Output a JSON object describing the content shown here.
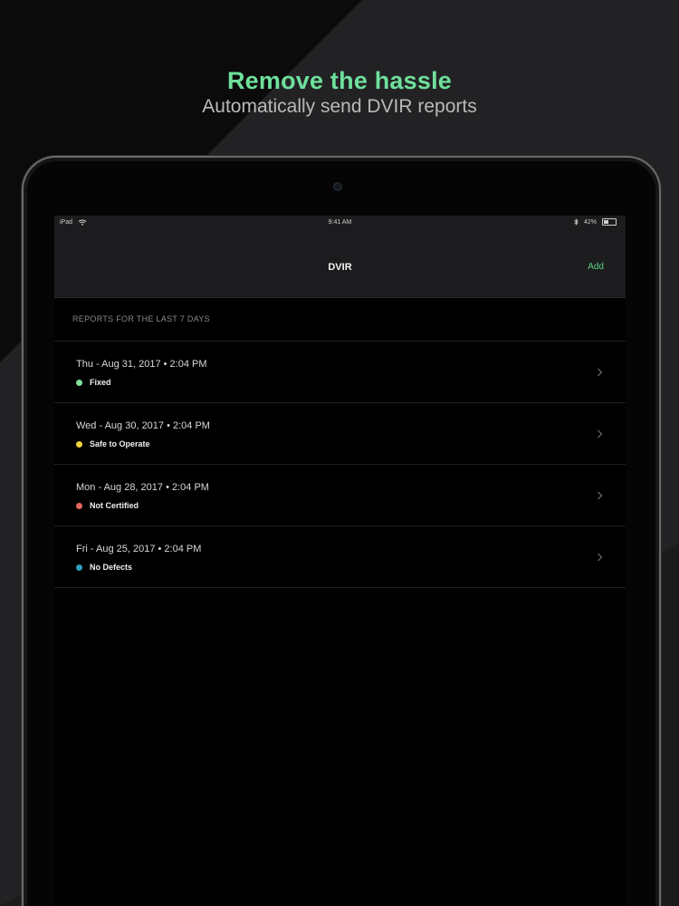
{
  "marketing": {
    "headline": "Remove the hassle",
    "subline": "Automatically send DVIR reports"
  },
  "statusbar": {
    "device": "iPad",
    "time": "9:41 AM",
    "battery_text": "42%",
    "battery_level": 0.42,
    "icons": [
      "wifi-icon",
      "bluetooth-icon",
      "battery-icon"
    ]
  },
  "navbar": {
    "title": "DVIR",
    "add_label": "Add"
  },
  "section": {
    "header": "REPORTS FOR THE LAST 7 DAYS"
  },
  "colors": {
    "accent": "#6ee09c",
    "fixed": "#7ee29a",
    "safe_to_operate": "#f2d33b",
    "not_certified": "#e46a5e",
    "no_defects": "#2e9fc0"
  },
  "reports": [
    {
      "date": "Thu - Aug 31, 2017 • 2:04 PM",
      "status": "Fixed",
      "color": "#7ee29a"
    },
    {
      "date": "Wed - Aug 30, 2017 • 2:04 PM",
      "status": "Safe to Operate",
      "color": "#f2d33b"
    },
    {
      "date": "Mon - Aug 28, 2017 • 2:04 PM",
      "status": "Not Certified",
      "color": "#e46a5e"
    },
    {
      "date": "Fri - Aug 25, 2017 • 2:04 PM",
      "status": "No Defects",
      "color": "#2e9fc0"
    }
  ]
}
